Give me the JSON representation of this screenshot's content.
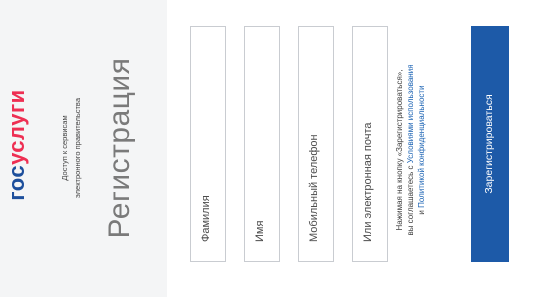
{
  "brand": {
    "logo_part1": "гос",
    "logo_part2": "услуги",
    "tagline_line1": "Доступ к сервисам",
    "tagline_line2": "электронного правительства"
  },
  "page": {
    "title": "Регистрация"
  },
  "form": {
    "lastname_placeholder": "Фамилия",
    "firstname_placeholder": "Имя",
    "phone_placeholder": "Мобильный телефон",
    "email_placeholder": "Или электронная почта"
  },
  "consent": {
    "line1": "Нажимая на кнопку «Зарегистрироваться»,",
    "line2_prefix": "вы соглашаетесь с ",
    "terms_link": "Условиями использования",
    "line3_prefix": "и ",
    "privacy_link": "Политикой конфиденциальности"
  },
  "actions": {
    "register_label": "Зарегистрироваться"
  },
  "colors": {
    "brand_blue": "#1d4f9c",
    "brand_red": "#ee2f53",
    "button_blue": "#1d5aa8",
    "link_blue": "#1d64b4",
    "panel_bg": "#f4f5f6"
  }
}
